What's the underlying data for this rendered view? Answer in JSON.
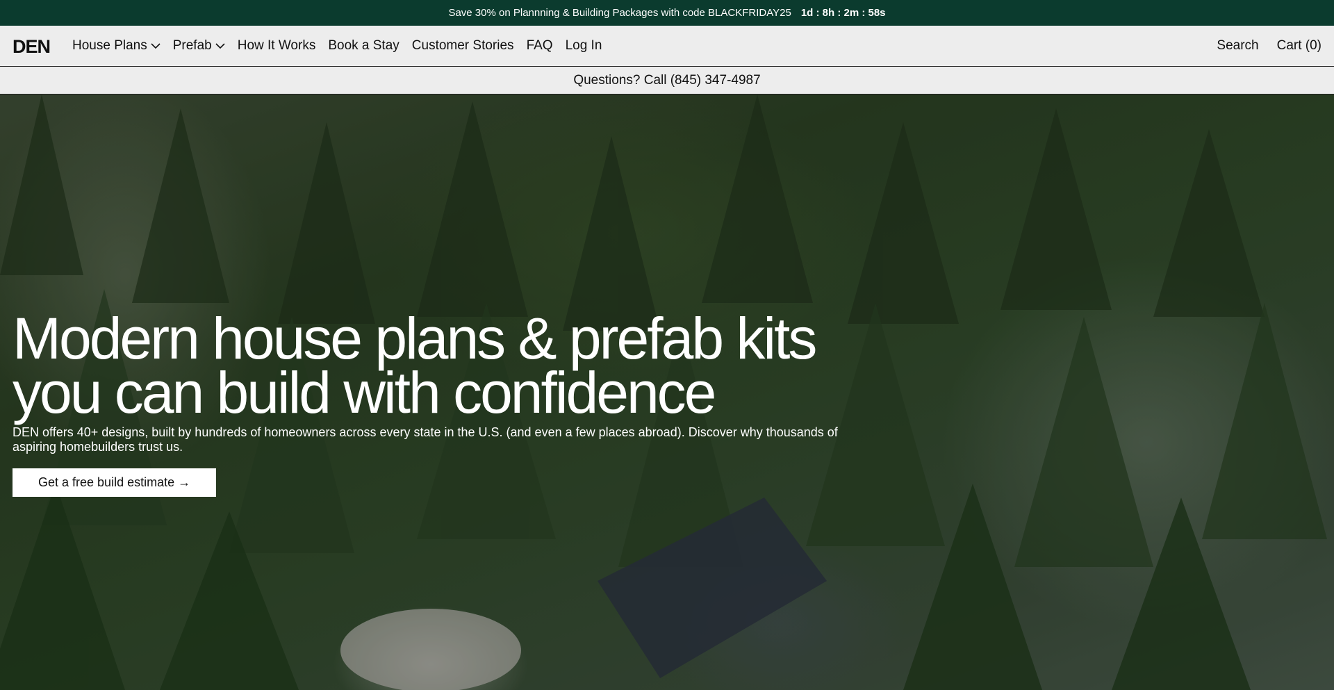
{
  "promo": {
    "text": "Save 30% on Plannning & Building Packages with code BLACKFRIDAY25",
    "countdown": "1d : 8h : 2m : 58s"
  },
  "nav": {
    "logo": "DEN",
    "items": [
      {
        "label": "House Plans",
        "dropdown": true
      },
      {
        "label": "Prefab",
        "dropdown": true
      },
      {
        "label": "How It Works"
      },
      {
        "label": "Book a Stay"
      },
      {
        "label": "Customer Stories"
      },
      {
        "label": "FAQ"
      },
      {
        "label": "Log In"
      }
    ],
    "search": "Search",
    "cart": "Cart (0)"
  },
  "phone_bar": {
    "text": "Questions? Call (845) 347-4987"
  },
  "hero": {
    "title_line1": "Modern house plans & prefab kits",
    "title_line2": "you can build with confidence",
    "subtitle": "DEN offers 40+ designs, built by hundreds of homeowners across every state in the U.S. (and even a few places abroad). Discover why thousands of aspiring homebuilders trust us.",
    "cta": "Get a free build estimate →"
  },
  "colors": {
    "promo_bg": "#0b3b2e",
    "nav_bg": "#ededed",
    "cta_bg": "#ffffff"
  }
}
